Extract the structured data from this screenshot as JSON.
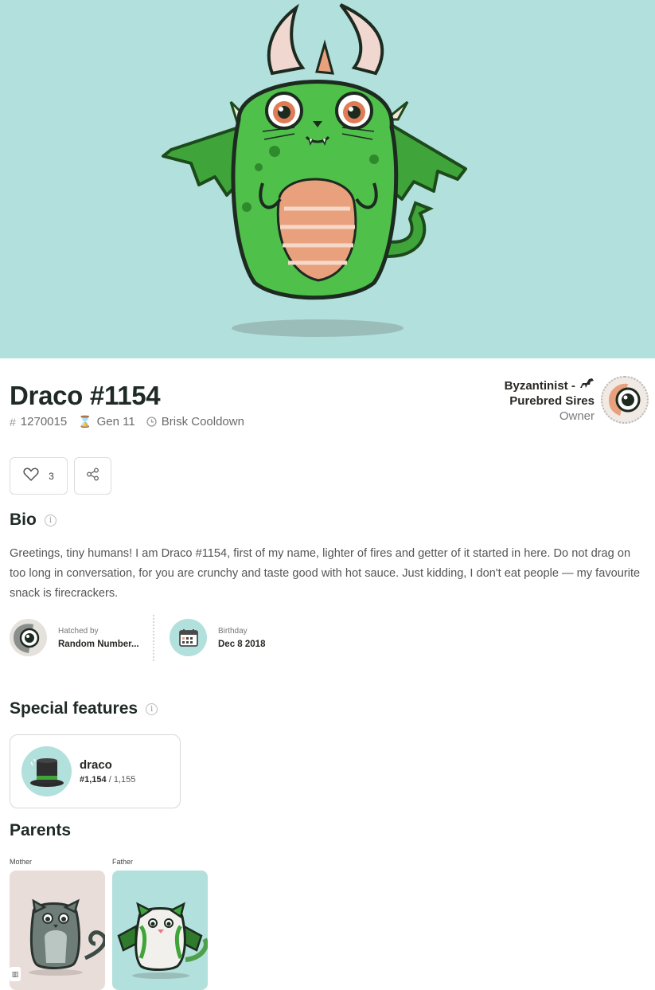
{
  "kitty": {
    "name": "Draco #1154",
    "id": "1270015",
    "generation": "Gen 11",
    "cooldown": "Brisk Cooldown",
    "likes": "3"
  },
  "owner": {
    "name_line1": "Byzantinist -",
    "name_line2": "Purebred Sires",
    "role": "Owner"
  },
  "bio": {
    "heading": "Bio",
    "text": "Greetings, tiny humans! I am Draco #1154, first of my name, lighter of fires and getter of it started in here. Do not drag on too long in conversation, for you are crunchy and taste good with hot sauce. Just kidding, I don't eat people — my favourite snack is firecrackers."
  },
  "facts": {
    "hatched_label": "Hatched by",
    "hatched_value": "Random Number...",
    "birthday_label": "Birthday",
    "birthday_value": "Dec 8 2018"
  },
  "special": {
    "heading": "Special features",
    "feature_name": "draco",
    "feature_rank": "#1,154",
    "feature_total": " / 1,155"
  },
  "parents": {
    "heading": "Parents",
    "mother_label": "Mother",
    "father_label": "Father"
  },
  "icons": {
    "id": "hash-icon",
    "gen": "hourglass-icon",
    "cooldown": "clock-icon",
    "like": "heart-icon",
    "share": "share-icon",
    "info": "info-icon",
    "owner_badge": "horse-icon"
  },
  "colors": {
    "hero_bg": "#b2e0dc",
    "mother_bg": "#e8ddd9",
    "father_bg": "#b2e0dc",
    "dragon_green": "#4fc04a",
    "belly": "#e9a07c"
  }
}
